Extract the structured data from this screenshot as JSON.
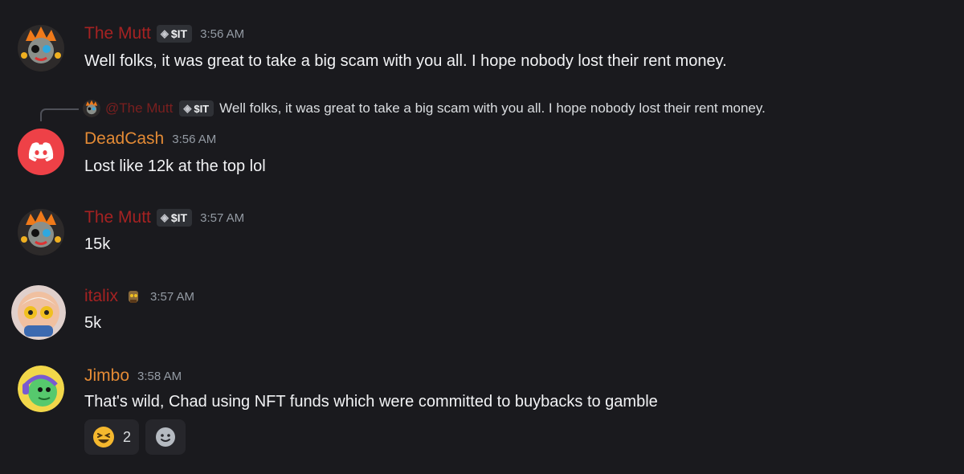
{
  "messages": [
    {
      "author": "The Mutt",
      "author_color": "#a52222",
      "tag": "$IT",
      "time": "3:56 AM",
      "text": "Well folks, it was great to take a big scam with you all. I hope nobody lost their rent money."
    },
    {
      "reply": {
        "author": "@The Mutt",
        "tag": "$IT",
        "text": "Well folks, it was great to take a big scam with you all. I hope nobody lost their rent money."
      },
      "author": "DeadCash",
      "author_color": "#e38a35",
      "time": "3:56 AM",
      "text": "Lost like 12k at the top lol"
    },
    {
      "author": "The Mutt",
      "author_color": "#a52222",
      "tag": "$IT",
      "time": "3:57 AM",
      "text": "15k"
    },
    {
      "author": "italix",
      "author_color": "#a52222",
      "time": "3:57 AM",
      "text": "5k"
    },
    {
      "author": "Jimbo",
      "author_color": "#e38a35",
      "time": "3:58 AM",
      "text": "That's wild, Chad using NFT funds which were committed to buybacks to gamble",
      "reactions": [
        {
          "emoji": "laughing-face",
          "count": "2"
        }
      ]
    }
  ]
}
